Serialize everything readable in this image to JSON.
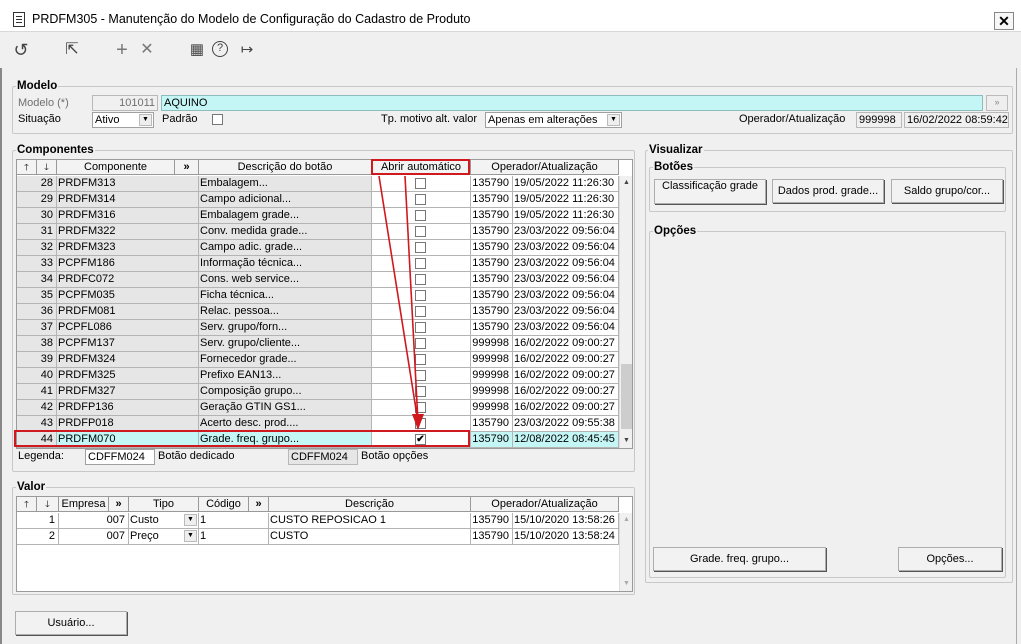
{
  "window": {
    "title": "PRDFM305 - Manutenção do Modelo de Configuração do Cadastro de Produto",
    "close": "✕"
  },
  "toolbar": {
    "icons": [
      "refresh-icon",
      "pointer-icon",
      "add-icon",
      "delete-icon",
      "calendar-icon",
      "help-icon",
      "exit-icon"
    ],
    "glyphs": [
      "↺",
      "⇱",
      "+",
      "✕",
      "▦",
      "?",
      "↦"
    ]
  },
  "modelo": {
    "title": "Modelo",
    "modelo_label": "Modelo (*)",
    "modelo_code": "101011",
    "modelo_name": "AQUINO",
    "situacao_label": "Situação",
    "situacao_value": "Ativo",
    "padrao_label": "Padrão",
    "tp_motivo_label": "Tp. motivo alt. valor",
    "tp_motivo_value": "Apenas em alterações",
    "operador_label": "Operador/Atualização",
    "operador_code": "999998",
    "operador_date": "16/02/2022 08:59:42"
  },
  "componentes": {
    "title": "Componentes",
    "headers": {
      "up": "🡑",
      "down": "🡓",
      "componente": "Componente",
      "more": "»",
      "descricao": "Descrição do botão",
      "abrir": "Abrir automático",
      "operador": "Operador/Atualização"
    },
    "rows": [
      {
        "n": "28",
        "comp": "PRDFM313",
        "desc": "Embalagem...",
        "checked": false,
        "op": "135790",
        "date": "19/05/2022 11:26:30"
      },
      {
        "n": "29",
        "comp": "PRDFM314",
        "desc": "Campo adicional...",
        "checked": false,
        "op": "135790",
        "date": "19/05/2022 11:26:30"
      },
      {
        "n": "30",
        "comp": "PRDFM316",
        "desc": "Embalagem grade...",
        "checked": false,
        "op": "135790",
        "date": "19/05/2022 11:26:30"
      },
      {
        "n": "31",
        "comp": "PRDFM322",
        "desc": "Conv. medida grade...",
        "checked": false,
        "op": "135790",
        "date": "23/03/2022 09:56:04"
      },
      {
        "n": "32",
        "comp": "PRDFM323",
        "desc": "Campo adic. grade...",
        "checked": false,
        "op": "135790",
        "date": "23/03/2022 09:56:04"
      },
      {
        "n": "33",
        "comp": "PCPFM186",
        "desc": "Informação técnica...",
        "checked": false,
        "op": "135790",
        "date": "23/03/2022 09:56:04"
      },
      {
        "n": "34",
        "comp": "PRDFC072",
        "desc": "Cons. web service...",
        "checked": false,
        "op": "135790",
        "date": "23/03/2022 09:56:04"
      },
      {
        "n": "35",
        "comp": "PCPFM035",
        "desc": "Ficha técnica...",
        "checked": false,
        "op": "135790",
        "date": "23/03/2022 09:56:04"
      },
      {
        "n": "36",
        "comp": "PRDFM081",
        "desc": "Relac. pessoa...",
        "checked": false,
        "op": "135790",
        "date": "23/03/2022 09:56:04"
      },
      {
        "n": "37",
        "comp": "PCPFL086",
        "desc": "Serv. grupo/forn...",
        "checked": false,
        "op": "135790",
        "date": "23/03/2022 09:56:04"
      },
      {
        "n": "38",
        "comp": "PCPFM137",
        "desc": "Serv. grupo/cliente...",
        "checked": false,
        "op": "999998",
        "date": "16/02/2022 09:00:27"
      },
      {
        "n": "39",
        "comp": "PRDFM324",
        "desc": "Fornecedor grade...",
        "checked": false,
        "op": "999998",
        "date": "16/02/2022 09:00:27"
      },
      {
        "n": "40",
        "comp": "PRDFM325",
        "desc": "Prefixo EAN13...",
        "checked": false,
        "op": "999998",
        "date": "16/02/2022 09:00:27"
      },
      {
        "n": "41",
        "comp": "PRDFM327",
        "desc": "Composição grupo...",
        "checked": false,
        "op": "999998",
        "date": "16/02/2022 09:00:27"
      },
      {
        "n": "42",
        "comp": "PRDFP136",
        "desc": "Geração GTIN GS1...",
        "checked": false,
        "op": "999998",
        "date": "16/02/2022 09:00:27"
      },
      {
        "n": "43",
        "comp": "PRDFP018",
        "desc": "Acerto desc. prod....",
        "checked": false,
        "op": "135790",
        "date": "23/03/2022 09:55:38"
      },
      {
        "n": "44",
        "comp": "PRDFM070",
        "desc": "Grade. freq. grupo...",
        "checked": true,
        "op": "135790",
        "date": "12/08/2022 08:45:45"
      }
    ],
    "legenda_label": "Legenda:",
    "legend1_code": "CDFFM024",
    "legend1_label": "Botão dedicado",
    "legend2_code": "CDFFM024",
    "legend2_label": "Botão opções"
  },
  "valor": {
    "title": "Valor",
    "headers": {
      "empresa": "Empresa",
      "more": "»",
      "tipo": "Tipo",
      "codigo": "Código",
      "descricao": "Descrição",
      "operador": "Operador/Atualização"
    },
    "rows": [
      {
        "n": "1",
        "empresa": "007",
        "tipo": "Custo",
        "codigo": "1",
        "desc": "CUSTO REPOSICAO 1",
        "op": "135790",
        "date": "15/10/2020 13:58:26"
      },
      {
        "n": "2",
        "empresa": "007",
        "tipo": "Preço",
        "codigo": "1",
        "desc": "CUSTO",
        "op": "135790",
        "date": "15/10/2020 13:58:24"
      }
    ]
  },
  "visualizar": {
    "title": "Visualizar",
    "botoes_title": "Botões",
    "btn1": "Classificação grade",
    "btn2": "Dados prod. grade...",
    "btn3": "Saldo grupo/cor...",
    "opcoes_title": "Opções",
    "btn_grade": "Grade. freq. grupo...",
    "btn_opcoes": "Opções..."
  },
  "footer": {
    "usuario": "Usuário..."
  },
  "colors": {
    "accent_cyan": "#c5f6f6",
    "highlight_red": "#d0191f"
  }
}
